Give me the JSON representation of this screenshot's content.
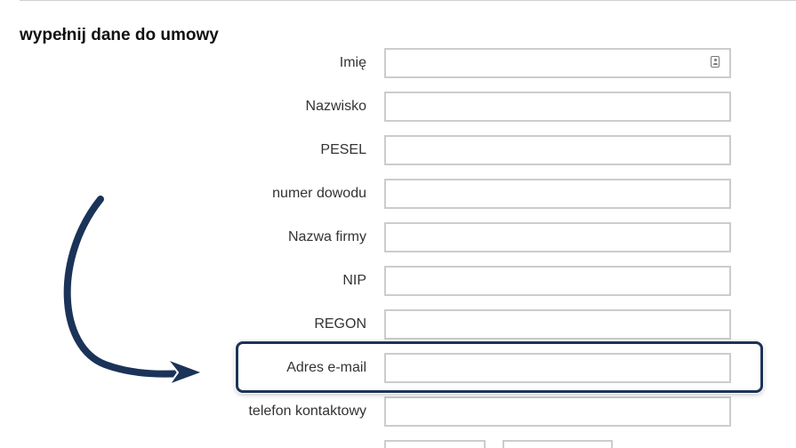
{
  "form": {
    "heading": "wypełnij dane do umowy",
    "fields": {
      "first_name": {
        "label": "Imię",
        "value": ""
      },
      "last_name": {
        "label": "Nazwisko",
        "value": ""
      },
      "pesel": {
        "label": "PESEL",
        "value": ""
      },
      "id_number": {
        "label": "numer dowodu",
        "value": ""
      },
      "company_name": {
        "label": "Nazwa firmy",
        "value": ""
      },
      "nip": {
        "label": "NIP",
        "value": ""
      },
      "regon": {
        "label": "REGON",
        "value": ""
      },
      "email": {
        "label": "Adres e-mail",
        "value": ""
      },
      "phone": {
        "label": "telefon kontaktowy",
        "value": ""
      }
    }
  },
  "annotation": {
    "highlighted_field": "email",
    "arrow_color": "#1b3358",
    "frame_color": "#1b3358"
  },
  "icons": {
    "autofill": "contact-card-icon"
  },
  "colors": {
    "input_border": "#cccccc",
    "label_text": "#333333",
    "heading_text": "#111111"
  }
}
